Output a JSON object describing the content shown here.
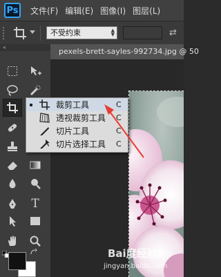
{
  "app": {
    "logo": "Ps"
  },
  "menubar": {
    "items": [
      {
        "label": "文件(F)"
      },
      {
        "label": "编辑(E)"
      },
      {
        "label": "图像(I)"
      },
      {
        "label": "图层(L)"
      }
    ]
  },
  "options_bar": {
    "tool_icon": "crop-icon",
    "ratio_select": {
      "value": "不受约束"
    },
    "swap_icon": "swap-arrows-icon"
  },
  "toolbox": {
    "header_glyph": "«",
    "tools": [
      {
        "name": "marquee-tool",
        "icon": "rect-marquee-icon"
      },
      {
        "name": "move-tool",
        "icon": "move-icon"
      },
      {
        "name": "lasso-tool",
        "icon": "lasso-icon"
      },
      {
        "name": "quick-select-tool",
        "icon": "quick-select-icon"
      },
      {
        "name": "crop-tool",
        "icon": "crop-icon",
        "active": true
      },
      {
        "name": "eyedropper-tool",
        "icon": "eyedropper-icon"
      },
      {
        "name": "healing-tool",
        "icon": "bandage-icon"
      },
      {
        "name": "brush-tool",
        "icon": "brush-icon"
      },
      {
        "name": "stamp-tool",
        "icon": "stamp-icon"
      },
      {
        "name": "history-brush-tool",
        "icon": "history-brush-icon"
      },
      {
        "name": "eraser-tool",
        "icon": "eraser-icon"
      },
      {
        "name": "gradient-tool",
        "icon": "gradient-icon"
      },
      {
        "name": "blur-tool",
        "icon": "drop-icon"
      },
      {
        "name": "dodge-tool",
        "icon": "dodge-icon"
      },
      {
        "name": "pen-tool",
        "icon": "pen-icon"
      },
      {
        "name": "type-tool",
        "icon": "type-icon"
      },
      {
        "name": "path-select-tool",
        "icon": "arrow-icon"
      },
      {
        "name": "shape-tool",
        "icon": "rectangle-icon"
      },
      {
        "name": "hand-tool",
        "icon": "hand-icon"
      },
      {
        "name": "zoom-tool",
        "icon": "zoom-icon"
      }
    ],
    "type_glyph": "T",
    "foreground_color": "#111111",
    "background_color": "#ffffff"
  },
  "document": {
    "tab_label": "pexels-brett-sayles-992734.jpg @ 50"
  },
  "flyout": {
    "items": [
      {
        "label": "裁剪工具",
        "shortcut": "C",
        "icon": "crop-icon",
        "selected": true
      },
      {
        "label": "透视裁剪工具",
        "shortcut": "C",
        "icon": "perspective-crop-icon"
      },
      {
        "label": "切片工具",
        "shortcut": "C",
        "icon": "slice-icon"
      },
      {
        "label": "切片选择工具",
        "shortcut": "C",
        "icon": "slice-select-icon"
      }
    ]
  },
  "annotation": {
    "arrow_color": "#e83c32"
  },
  "watermark": {
    "brand": "Bai度经验",
    "url": "jingyan.baidu.com"
  }
}
